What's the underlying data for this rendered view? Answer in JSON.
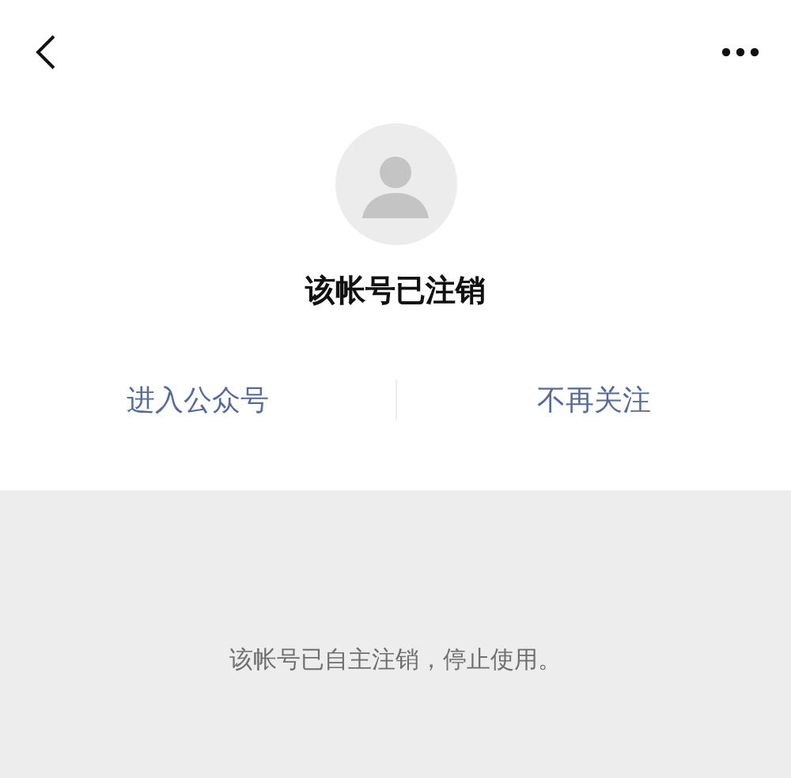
{
  "profile": {
    "name": "该帐号已注销"
  },
  "actions": [
    {
      "label": "进入公众号"
    },
    {
      "label": "不再关注"
    }
  ],
  "notice": "该帐号已自主注销，停止使用。"
}
